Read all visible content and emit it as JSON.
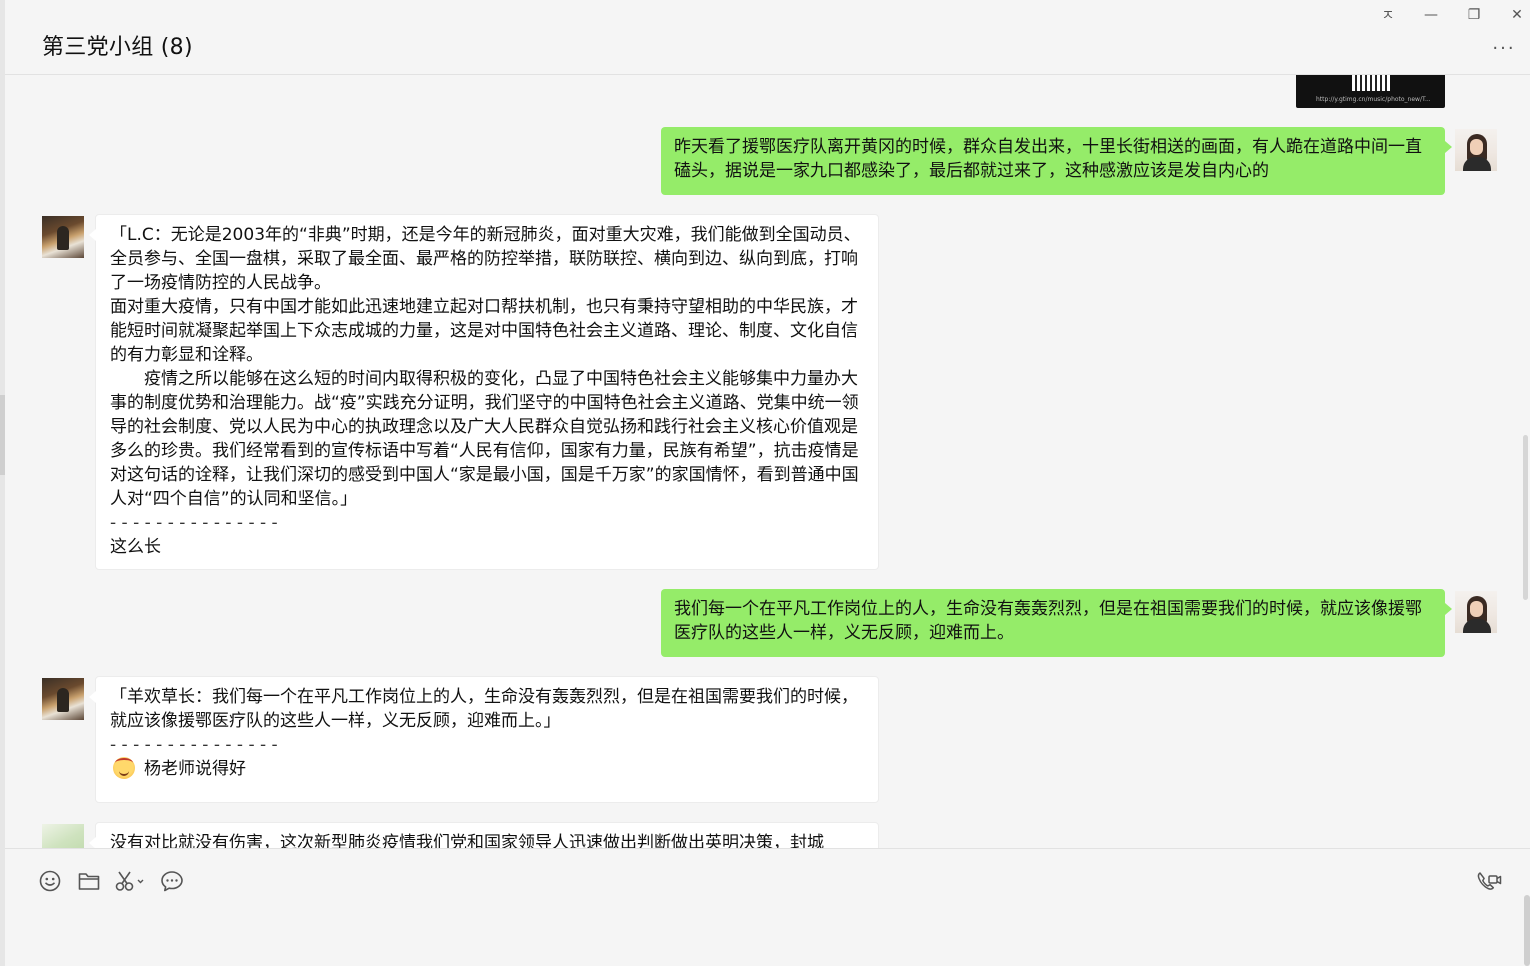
{
  "window": {
    "title": "第三党小组 (8)",
    "pin_glyph": "ㅈ",
    "minimize_glyph": "—",
    "restore_glyph": "❐",
    "close_glyph": "✕",
    "more_glyph": "···"
  },
  "messages": {
    "image_url_text": "http://y.gtimg.cn/music/photo_new/T...",
    "m1_self": "昨天看了援鄂医疗队离开黄冈的时候，群众自发出来，十里长街相送的画面，有人跪在道路中间一直磕头，据说是一家九口都感染了，最后都就过来了，这种感激应该是发自内心的",
    "m2_other": "「L.C：无论是2003年的“非典”时期，还是今年的新冠肺炎，面对重大灾难，我们能做到全国动员、全员参与、全国一盘棋，采取了最全面、最严格的防控举措，联防联控、横向到边、纵向到底，打响了一场疫情防控的人民战争。\n面对重大疫情，只有中国才能如此迅速地建立起对口帮扶机制，也只有秉持守望相助的中华民族，才能短时间就凝聚起举国上下众志成城的力量，这是对中国特色社会主义道路、理论、制度、文化自信的有力彰显和诠释。\n　　疫情之所以能够在这么短的时间内取得积极的变化，凸显了中国特色社会主义能够集中力量办大事的制度优势和治理能力。战“疫”实践充分证明，我们坚守的中国特色社会主义道路、党集中统一领导的社会制度、党以人民为中心的执政理念以及广大人民群众自觉弘扬和践行社会主义核心价值观是多么的珍贵。我们经常看到的宣传标语中写着“人民有信仰，国家有力量，民族有希望”，抗击疫情是对这句话的诠释，让我们深切的感受到中国人“家是最小国，国是千万家”的家国情怀，看到普通中国人对“四个自信”的认同和坚信。」",
    "m2_separator": "- - - - - - - - - - - - - - -",
    "m2_reply": "这么长",
    "m3_self": "我们每一个在平凡工作岗位上的人，生命没有轰轰烈烈，但是在祖国需要我们的时候，就应该像援鄂医疗队的这些人一样，义无反顾，迎难而上。",
    "m4_quote": "「羊欢草长：我们每一个在平凡工作岗位上的人，生命没有轰轰烈烈，但是在祖国需要我们的时候，就应该像援鄂医疗队的这些人一样，义无反顾，迎难而上。」",
    "m4_separator": "- - - - - - - - - - - - - - -",
    "m4_reply": "杨老师说得好",
    "m5_other": "没有对比就没有伤害，这次新型肺炎疫情我们党和国家领导人迅速做出判断做出英明决策，封城"
  },
  "icons": {
    "emoji": "emoji-icon",
    "folder": "folder-icon",
    "scissors": "scissors-icon",
    "chat": "chat-history-icon",
    "call": "video-call-icon"
  },
  "colors": {
    "self_bubble": "#95ec69",
    "other_bubble": "#ffffff",
    "background": "#f5f5f5"
  }
}
